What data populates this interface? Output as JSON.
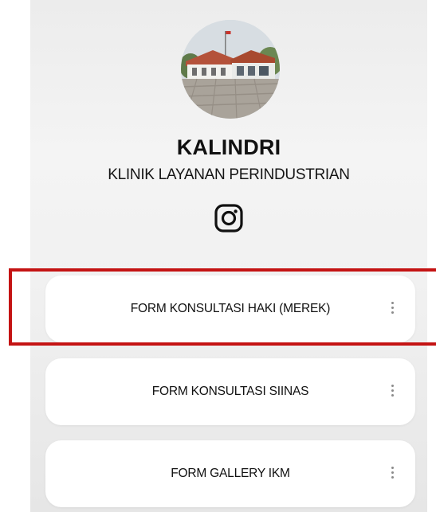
{
  "profile": {
    "name": "KALINDRI",
    "tagline": "KLINIK LAYANAN PERINDUSTRIAN",
    "social_icon": "instagram-icon"
  },
  "links": [
    {
      "label": "FORM KONSULTASI HAKI (MEREK)",
      "menu_icon": "kebab-menu-icon",
      "highlighted": true
    },
    {
      "label": "FORM KONSULTASI SIINAS",
      "menu_icon": "kebab-menu-icon",
      "highlighted": false
    },
    {
      "label": "FORM GALLERY IKM",
      "menu_icon": "kebab-menu-icon",
      "highlighted": false
    }
  ],
  "colors": {
    "background": "#f1f1f1",
    "card": "#ffffff",
    "text": "#111111",
    "highlight_border": "#c41313",
    "kebab": "#8a8a8a"
  }
}
